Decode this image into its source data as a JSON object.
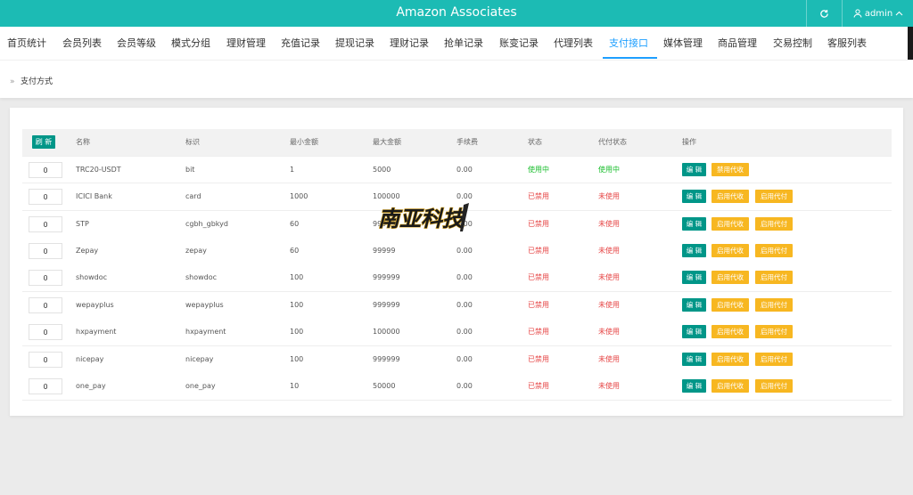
{
  "header": {
    "title": "Amazon Associates",
    "user_name": "admin",
    "icons": {
      "refresh": "refresh-icon",
      "user": "user-icon",
      "dropdown": "chevron-up-icon"
    },
    "color": "#1cbbb4"
  },
  "nav": {
    "items": [
      "首页统计",
      "会员列表",
      "会员等级",
      "模式分组",
      "理财管理",
      "充值记录",
      "提现记录",
      "理财记录",
      "抢单记录",
      "账变记录",
      "代理列表",
      "支付接口",
      "媒体管理",
      "商品管理",
      "交易控制",
      "客服列表"
    ],
    "active": "支付接口",
    "active_color": "#1e9fff"
  },
  "breadcrumb": {
    "label": "支付方式",
    "icon": "double-chevron-right-icon"
  },
  "table": {
    "refresh_label": "刷 新",
    "columns": [
      "名称",
      "标识",
      "最小金额",
      "最大金额",
      "手续费",
      "状态",
      "代付状态",
      "操作"
    ],
    "rows": [
      {
        "order": "0",
        "name": "TRC20-USDT",
        "code": "bit",
        "min": "1",
        "max": "5000",
        "fee": "0.00",
        "status": "使用中",
        "status_on": true,
        "pay_status": "使用中",
        "pay_on": true,
        "edit": "编 辑",
        "btn1": "禁用代收",
        "btn2": ""
      },
      {
        "order": "0",
        "name": "ICICI Bank",
        "code": "card",
        "min": "1000",
        "max": "100000",
        "fee": "0.00",
        "status": "已禁用",
        "status_on": false,
        "pay_status": "未使用",
        "pay_on": false,
        "edit": "编 辑",
        "btn1": "启用代收",
        "btn2": "启用代付"
      },
      {
        "order": "0",
        "name": "STP",
        "code": "cgbh_gbkyd",
        "min": "60",
        "max": "99999",
        "fee": "0.00",
        "status": "已禁用",
        "status_on": false,
        "pay_status": "未使用",
        "pay_on": false,
        "edit": "编 辑",
        "btn1": "启用代收",
        "btn2": "启用代付"
      },
      {
        "order": "0",
        "name": "Zepay",
        "code": "zepay",
        "min": "60",
        "max": "99999",
        "fee": "0.00",
        "status": "已禁用",
        "status_on": false,
        "pay_status": "未使用",
        "pay_on": false,
        "edit": "编 辑",
        "btn1": "启用代收",
        "btn2": "启用代付"
      },
      {
        "order": "0",
        "name": "showdoc",
        "code": "showdoc",
        "min": "100",
        "max": "999999",
        "fee": "0.00",
        "status": "已禁用",
        "status_on": false,
        "pay_status": "未使用",
        "pay_on": false,
        "edit": "编 辑",
        "btn1": "启用代收",
        "btn2": "启用代付"
      },
      {
        "order": "0",
        "name": "wepayplus",
        "code": "wepayplus",
        "min": "100",
        "max": "999999",
        "fee": "0.00",
        "status": "已禁用",
        "status_on": false,
        "pay_status": "未使用",
        "pay_on": false,
        "edit": "编 辑",
        "btn1": "启用代收",
        "btn2": "启用代付"
      },
      {
        "order": "0",
        "name": "hxpayment",
        "code": "hxpayment",
        "min": "100",
        "max": "100000",
        "fee": "0.00",
        "status": "已禁用",
        "status_on": false,
        "pay_status": "未使用",
        "pay_on": false,
        "edit": "编 辑",
        "btn1": "启用代收",
        "btn2": "启用代付"
      },
      {
        "order": "0",
        "name": "nicepay",
        "code": "nicepay",
        "min": "100",
        "max": "999999",
        "fee": "0.00",
        "status": "已禁用",
        "status_on": false,
        "pay_status": "未使用",
        "pay_on": false,
        "edit": "编 辑",
        "btn1": "启用代收",
        "btn2": "启用代付"
      },
      {
        "order": "0",
        "name": "one_pay",
        "code": "one_pay",
        "min": "10",
        "max": "50000",
        "fee": "0.00",
        "status": "已禁用",
        "status_on": false,
        "pay_status": "未使用",
        "pay_on": false,
        "edit": "编 辑",
        "btn1": "启用代收",
        "btn2": "启用代付"
      }
    ]
  },
  "watermark": {
    "text": "南亚科技"
  },
  "colors": {
    "on": "#19be2c",
    "off": "#e64545",
    "teal_button": "#009688",
    "yellow_button": "#f7b721"
  }
}
